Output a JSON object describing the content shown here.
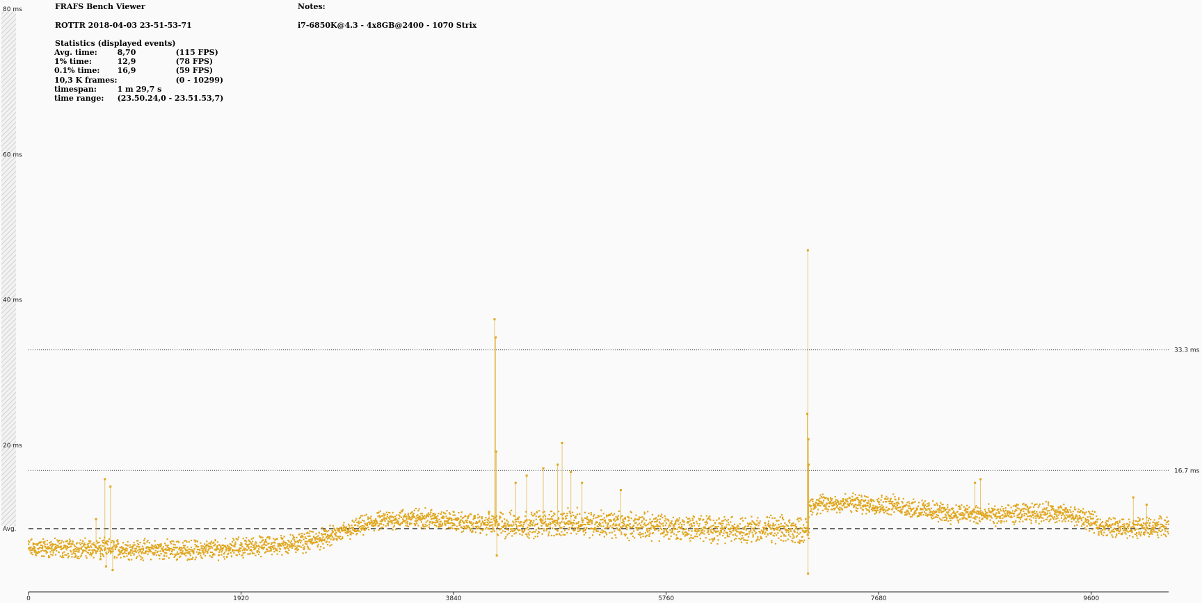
{
  "header": {
    "app_title": "FRAFS Bench Viewer",
    "run_name": "ROTTR 2018-04-03 23-51-53-71",
    "notes_label": "Notes:",
    "notes_text": "i7-6850K@4.3 - 4x8GB@2400 - 1070 Strix"
  },
  "statistics": {
    "heading": "Statistics (displayed events)",
    "rows": [
      {
        "label": "Avg. time:",
        "value": "8,70",
        "extra": "(115 FPS)"
      },
      {
        "label": "1% time:",
        "value": "12,9",
        "extra": "(78 FPS)"
      },
      {
        "label": "0.1% time:",
        "value": "16,9",
        "extra": "(59 FPS)"
      },
      {
        "label": "10,3 K frames:",
        "value": "",
        "extra": "(0 - 10299)"
      },
      {
        "label": "timespan:",
        "value": "1 m 29,7 s",
        "extra": ""
      },
      {
        "label": "time range:",
        "value": "(23.50.24,0 - 23.51.53,7)",
        "extra": ""
      }
    ]
  },
  "chart_data": {
    "type": "scatter",
    "title": "",
    "xlabel": "",
    "ylabel": "",
    "xlim": [
      0,
      10299
    ],
    "ylim": [
      0,
      80
    ],
    "x_ticks": [
      0,
      1920,
      3840,
      5760,
      7680,
      9600
    ],
    "y_tick_labels": [
      {
        "value": 80,
        "label": "80 ms"
      },
      {
        "value": 60,
        "label": "60 ms"
      },
      {
        "value": 40,
        "label": "40 ms"
      },
      {
        "value": 20,
        "label": "20 ms"
      }
    ],
    "reference_lines": [
      {
        "value": 33.3,
        "label": "33.3 ms",
        "style": "dotted"
      },
      {
        "value": 16.7,
        "label": "16.7 ms",
        "style": "dotted"
      },
      {
        "value": 8.7,
        "label": "Avg.",
        "style": "dashed"
      }
    ],
    "series_color": "#e0a61e",
    "baseline_profile": [
      [
        0,
        6.0
      ],
      [
        600,
        6.0
      ],
      [
        1200,
        5.8
      ],
      [
        1600,
        5.8
      ],
      [
        2000,
        6.2
      ],
      [
        2400,
        6.6
      ],
      [
        2700,
        7.5
      ],
      [
        2900,
        8.5
      ],
      [
        3100,
        9.5
      ],
      [
        3300,
        10.0
      ],
      [
        3600,
        10.2
      ],
      [
        3800,
        9.8
      ],
      [
        4000,
        9.4
      ],
      [
        4300,
        9.2
      ],
      [
        4600,
        9.4
      ],
      [
        5000,
        9.6
      ],
      [
        5400,
        9.2
      ],
      [
        5800,
        8.9
      ],
      [
        6200,
        8.7
      ],
      [
        6600,
        8.6
      ],
      [
        7000,
        8.5
      ],
      [
        7049,
        8.5
      ],
      [
        7050,
        12.0
      ],
      [
        7400,
        12.2
      ],
      [
        7800,
        12.0
      ],
      [
        8200,
        11.0
      ],
      [
        8700,
        10.5
      ],
      [
        9200,
        11.0
      ],
      [
        9500,
        10.3
      ],
      [
        9700,
        9.0
      ],
      [
        10000,
        8.8
      ],
      [
        10299,
        9.0
      ]
    ],
    "spikes": [
      {
        "x": 690,
        "y": 15.5
      },
      {
        "x": 700,
        "y": 3.5
      },
      {
        "x": 740,
        "y": 14.5
      },
      {
        "x": 760,
        "y": 3.0
      },
      {
        "x": 610,
        "y": 10.0
      },
      {
        "x": 650,
        "y": 4.5
      },
      {
        "x": 4210,
        "y": 37.5
      },
      {
        "x": 4220,
        "y": 35.0
      },
      {
        "x": 4225,
        "y": 19.3
      },
      {
        "x": 4230,
        "y": 5.0
      },
      {
        "x": 4160,
        "y": 11.0
      },
      {
        "x": 4400,
        "y": 15.0
      },
      {
        "x": 4500,
        "y": 16.0
      },
      {
        "x": 4650,
        "y": 17.0
      },
      {
        "x": 4780,
        "y": 17.5
      },
      {
        "x": 4820,
        "y": 20.5
      },
      {
        "x": 4900,
        "y": 16.5
      },
      {
        "x": 5000,
        "y": 15.0
      },
      {
        "x": 5350,
        "y": 14.0
      },
      {
        "x": 7040,
        "y": 47.0
      },
      {
        "x": 7035,
        "y": 24.5
      },
      {
        "x": 7045,
        "y": 21.0
      },
      {
        "x": 7048,
        "y": 17.5
      },
      {
        "x": 7042,
        "y": 2.5
      },
      {
        "x": 8550,
        "y": 15.0
      },
      {
        "x": 8600,
        "y": 15.5
      },
      {
        "x": 9370,
        "y": 11.5
      },
      {
        "x": 9980,
        "y": 13.0
      },
      {
        "x": 10100,
        "y": 12.0
      }
    ],
    "noise_band_ms": 1.6
  }
}
